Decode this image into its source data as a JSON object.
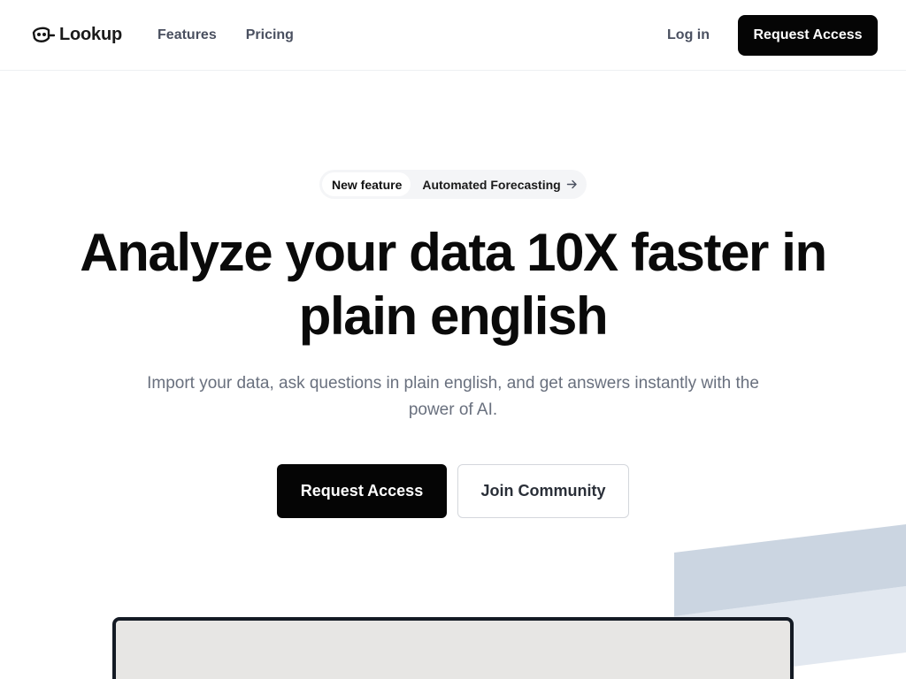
{
  "header": {
    "brand": "Lookup",
    "nav": [
      {
        "label": "Features"
      },
      {
        "label": "Pricing"
      }
    ],
    "login_label": "Log in",
    "cta_label": "Request Access"
  },
  "announcement": {
    "tag": "New feature",
    "text": "Automated Forecasting"
  },
  "hero": {
    "title_line1": "Analyze your data 10X faster in",
    "title_line2": "plain english",
    "subtitle": "Import your data, ask questions in plain english, and get answers instantly with the power of AI.",
    "primary_cta": "Request Access",
    "secondary_cta": "Join Community"
  },
  "colors": {
    "primary": "#050505",
    "text_muted": "#69707e",
    "decor_blue": "#cbd5e1"
  }
}
